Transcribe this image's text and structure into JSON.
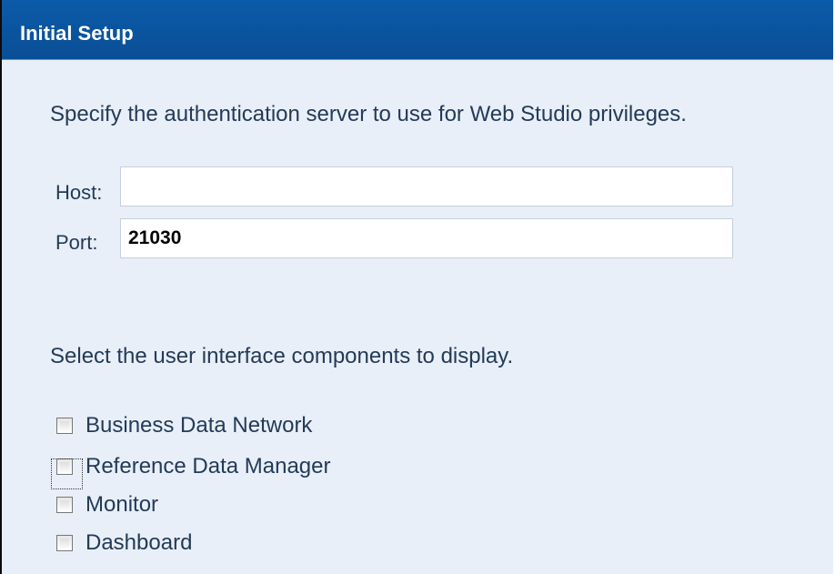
{
  "window": {
    "title": "Initial Setup"
  },
  "authentication": {
    "instruction": "Specify the authentication server to use for Web Studio privileges.",
    "host_label": "Host:",
    "host_value": "",
    "port_label": "Port:",
    "port_value": "21030"
  },
  "components": {
    "instruction": "Select the user interface components to display.",
    "items": [
      {
        "label": "Business Data Network",
        "checked": false
      },
      {
        "label": "Reference Data Manager",
        "checked": false,
        "focused": true
      },
      {
        "label": "Monitor",
        "checked": false
      },
      {
        "label": "Dashboard",
        "checked": false
      }
    ]
  },
  "colors": {
    "title_bar": "#0b5aa8",
    "panel_background": "#e8eff8",
    "text": "#243a57"
  },
  "icons": {
    "checkbox": "unchecked-checkbox-icon"
  }
}
